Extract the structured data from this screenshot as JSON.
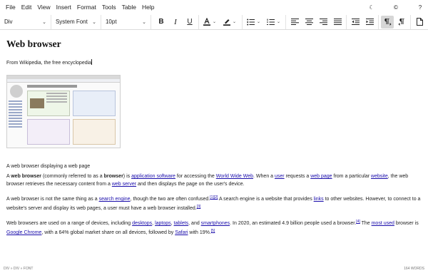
{
  "menubar": {
    "items": [
      "File",
      "Edit",
      "View",
      "Insert",
      "Format",
      "Tools",
      "Table",
      "Help"
    ],
    "right_icons": [
      "moon-icon",
      "copyright-icon",
      "help-icon"
    ],
    "right_glyphs": [
      "☾",
      "©",
      "?"
    ]
  },
  "toolbar": {
    "block_format": "Div",
    "font_family": "System Font",
    "font_size": "10pt"
  },
  "document": {
    "title": "Web browser",
    "subtitle": "From Wikipedia, the free encyclopedia",
    "caption": "A web browser displaying a web page",
    "p1": {
      "t1": "A ",
      "b1": "web browser",
      "t2": " (commonly referred to as a ",
      "b2": "browser",
      "t3": ") is ",
      "l1": "application software",
      "t4": " for accessing the ",
      "l2": "World Wide Web",
      "t5": ". When a ",
      "l3": "user",
      "t6": " requests a ",
      "l4": "web page",
      "t7": " from a particular ",
      "l5": "website",
      "t8": ", the web browser retrieves the necessary content from a ",
      "l6": "web server",
      "t9": " and then displays the page on the user's device."
    },
    "p2": {
      "t1": "A web browser is not the same thing as a ",
      "l1": "search engine",
      "t2": ", though the two are often confused.",
      "r1": "[1][2]",
      "t3": " A search engine is a website that provides ",
      "l2": "links",
      "t4": " to other websites. However, to connect to a website's server and display its web pages, a user must have a web browser installed.",
      "r2": "[3]"
    },
    "p3": {
      "t1": "Web browsers are used on a range of devices, including ",
      "l1": "desktops",
      "t2": ", ",
      "l2": "laptops",
      "t3": ", ",
      "l3": "tablets",
      "t4": ", and ",
      "l4": "smartphones",
      "t5": ". In 2020, an estimated 4.9 billion people used a browser.",
      "r1": "[4]",
      "t6": " The ",
      "l5": "most used",
      "t7": " browser is ",
      "l6": "Google Chrome",
      "t8": ", with a 64% global market share on all devices, followed by ",
      "l7": "Safari",
      "t9": " with 19%.",
      "r2": "[5]"
    }
  },
  "statusbar": {
    "path": "DIV » DIV » FONT",
    "word_count": "164 WORDS"
  },
  "colors": {
    "link": "#1a0dab",
    "active_button": "#d6d6d6"
  }
}
